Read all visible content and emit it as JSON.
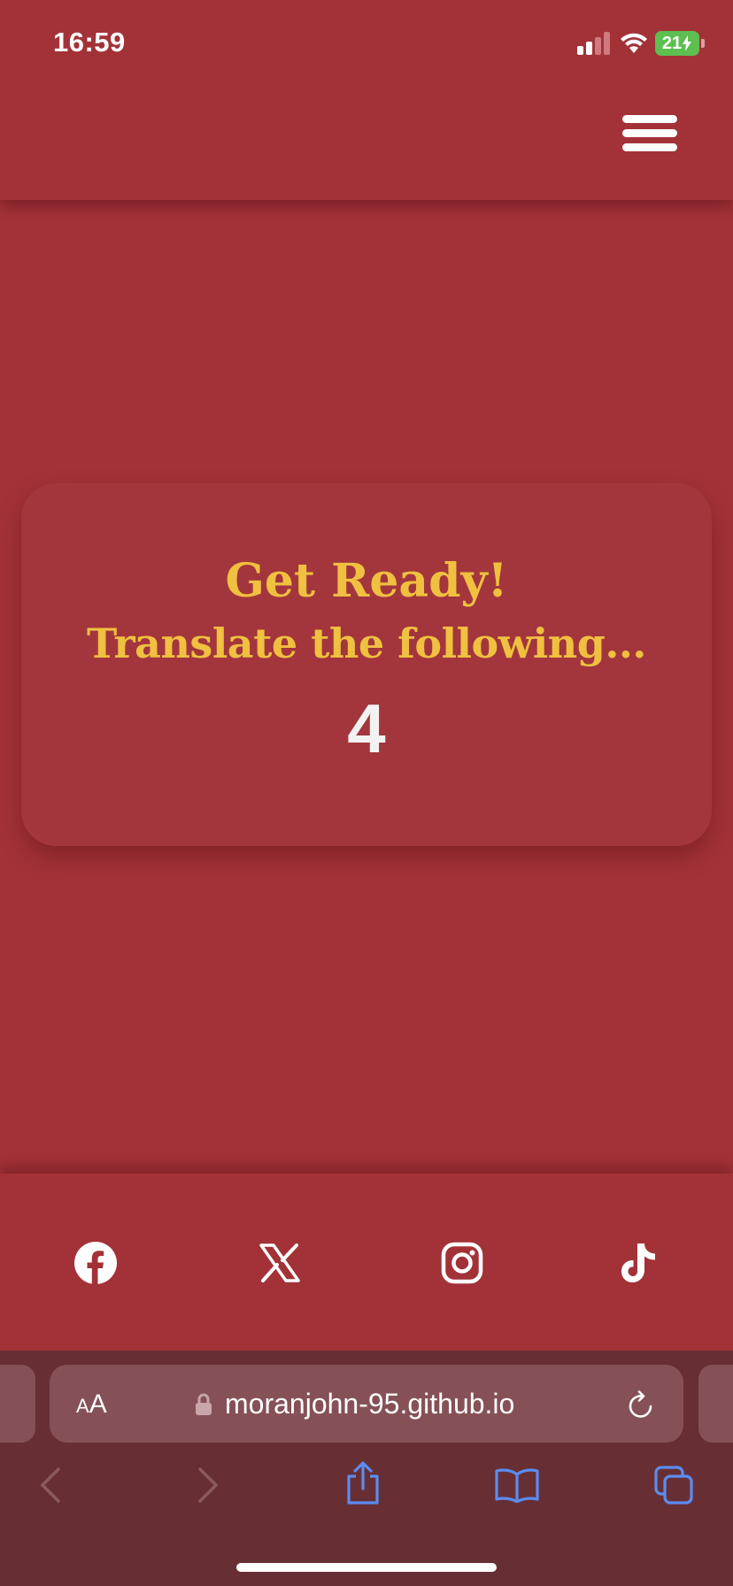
{
  "status_bar": {
    "time": "16:59",
    "battery": "21"
  },
  "header": {
    "menu_icon": "hamburger-menu-icon"
  },
  "card": {
    "title": "Get Ready!",
    "subtitle": "Translate the following...",
    "countdown": "4"
  },
  "footer": {
    "social_icons": [
      "facebook-icon",
      "x-icon",
      "instagram-icon",
      "tiktok-icon"
    ]
  },
  "browser": {
    "aa_small": "A",
    "aa_big": "A",
    "url": "moranjohn-95.github.io",
    "toolbar_icons": [
      "back-icon",
      "forward-icon",
      "share-icon",
      "bookmarks-icon",
      "tabs-icon"
    ]
  },
  "colors": {
    "background": "#a33238",
    "accent_gold": "#f0c040",
    "safari_bar": "#672f34",
    "safari_blue": "#5b8cf0"
  }
}
